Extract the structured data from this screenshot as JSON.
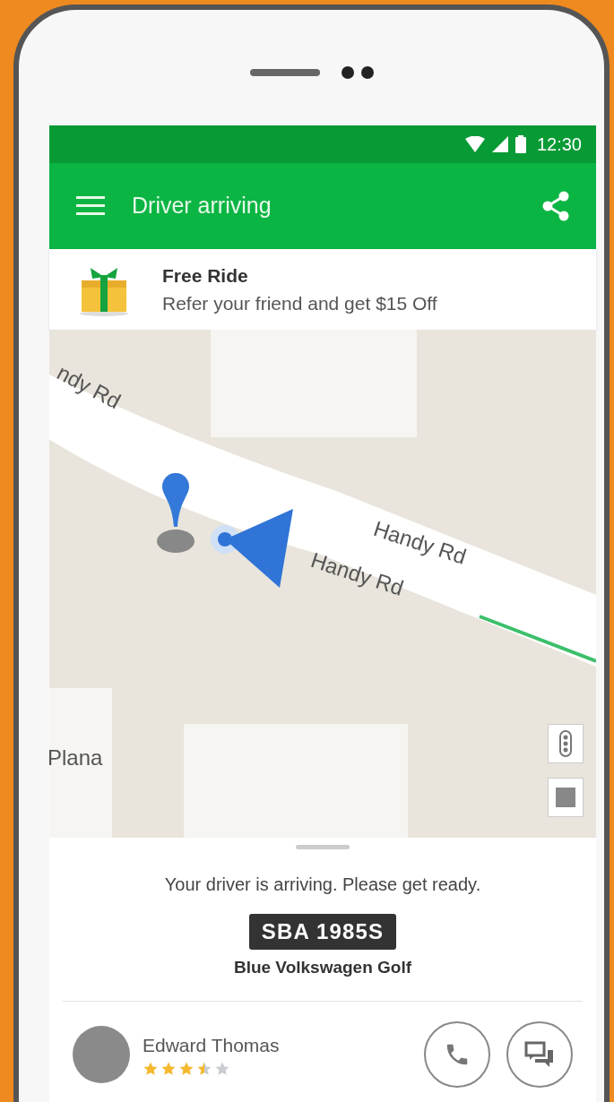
{
  "status_bar": {
    "time": "12:30"
  },
  "app_bar": {
    "title": "Driver arriving"
  },
  "promo": {
    "title": "Free Ride",
    "subtitle": "Refer your friend and get $15 Off"
  },
  "map": {
    "labels": [
      {
        "text": "ndy Rd"
      },
      {
        "text": "Handy Rd"
      },
      {
        "text": "Handy Rd"
      },
      {
        "text": "Plana"
      }
    ]
  },
  "trip": {
    "message": "Your driver is arriving. Please get ready.",
    "plate": "SBA 1985S",
    "car": "Blue Volkswagen Golf"
  },
  "driver": {
    "name": "Edward Thomas",
    "stars": 3.5
  }
}
